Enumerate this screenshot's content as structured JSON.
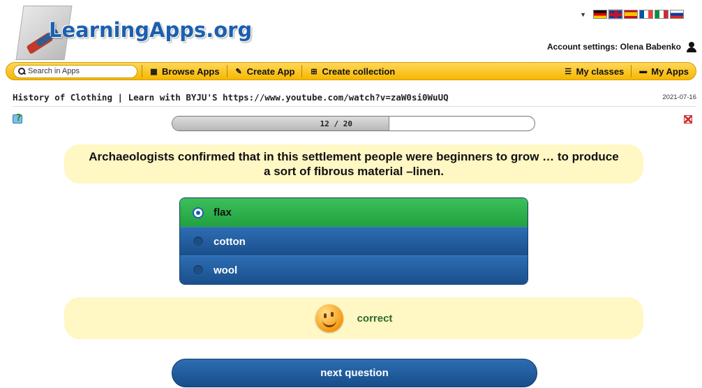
{
  "header": {
    "logo_text": "LearningApps.org",
    "languages": [
      "de",
      "en",
      "es",
      "fr",
      "it",
      "ru"
    ],
    "account_label": "Account settings: Olena Babenko"
  },
  "nav": {
    "search_placeholder": "Search in Apps",
    "browse_apps": "Browse Apps",
    "create_app": "Create App",
    "create_collection": "Create collection",
    "my_classes": "My classes",
    "my_apps": "My Apps"
  },
  "app": {
    "title": "History of Clothing | Learn with BYJU'S https://www.youtube.com/watch?v=zaW0si0WuUQ",
    "date": "2021-07-16"
  },
  "progress": {
    "label": "12 / 20",
    "current": 12,
    "total": 20
  },
  "quiz": {
    "question": "Archaeologists confirmed that in this settlement people were beginners to grow … to produce a sort of fibrous material –linen.",
    "options": [
      {
        "label": "flax",
        "state": "correct-selected"
      },
      {
        "label": "cotton",
        "state": "unselected"
      },
      {
        "label": "wool",
        "state": "unselected"
      }
    ],
    "feedback": "correct",
    "next_label": "next question"
  },
  "colors": {
    "nav_yellow": "#f5b800",
    "correct_green": "#21a03f",
    "option_blue": "#1a4f8c",
    "panel_cream": "#fff7c4"
  }
}
